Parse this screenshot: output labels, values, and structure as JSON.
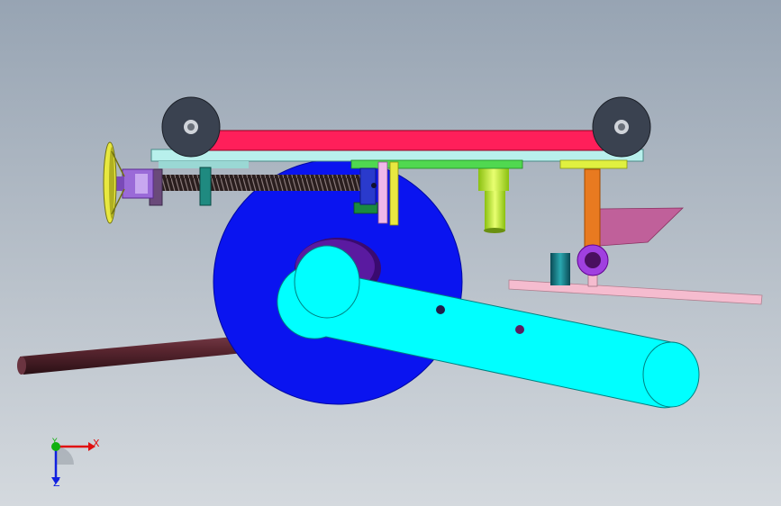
{
  "viewport": {
    "background_top": "#97a4b3",
    "background_bottom": "#d4d9de"
  },
  "model": {
    "components": [
      {
        "name": "drive-wheel",
        "color": "#0a14f0"
      },
      {
        "name": "crank-arm",
        "color": "#00ffff"
      },
      {
        "name": "push-rod",
        "color": "#5a2630"
      },
      {
        "name": "top-plate",
        "color": "#ff1f5a"
      },
      {
        "name": "base-frame",
        "color": "#b8f0ec"
      },
      {
        "name": "roller",
        "color": "#3a4250"
      },
      {
        "name": "lead-screw",
        "color": "#3b2a2a"
      },
      {
        "name": "handwheel",
        "color": "#e8e840"
      },
      {
        "name": "coupling",
        "color": "#9a6ad8"
      },
      {
        "name": "clamp-block",
        "color": "#1f8a80"
      },
      {
        "name": "slider-post",
        "color": "#2a3acc"
      },
      {
        "name": "guide-bar",
        "color": "#50d850"
      },
      {
        "name": "sleeve",
        "color": "#c8ff40"
      },
      {
        "name": "pin-bracket",
        "color": "#e87a20"
      },
      {
        "name": "pivot-ring",
        "color": "#a040e0"
      },
      {
        "name": "plate-flag",
        "color": "#c0609a"
      },
      {
        "name": "sensor-post",
        "color": "#10707a"
      },
      {
        "name": "rail-bar",
        "color": "#f5bccf"
      }
    ]
  },
  "triad": {
    "x_label": "X",
    "y_label": "Y",
    "z_label": "Z",
    "x_color": "#e01010",
    "y_color": "#10b010",
    "z_color": "#1020e0"
  }
}
